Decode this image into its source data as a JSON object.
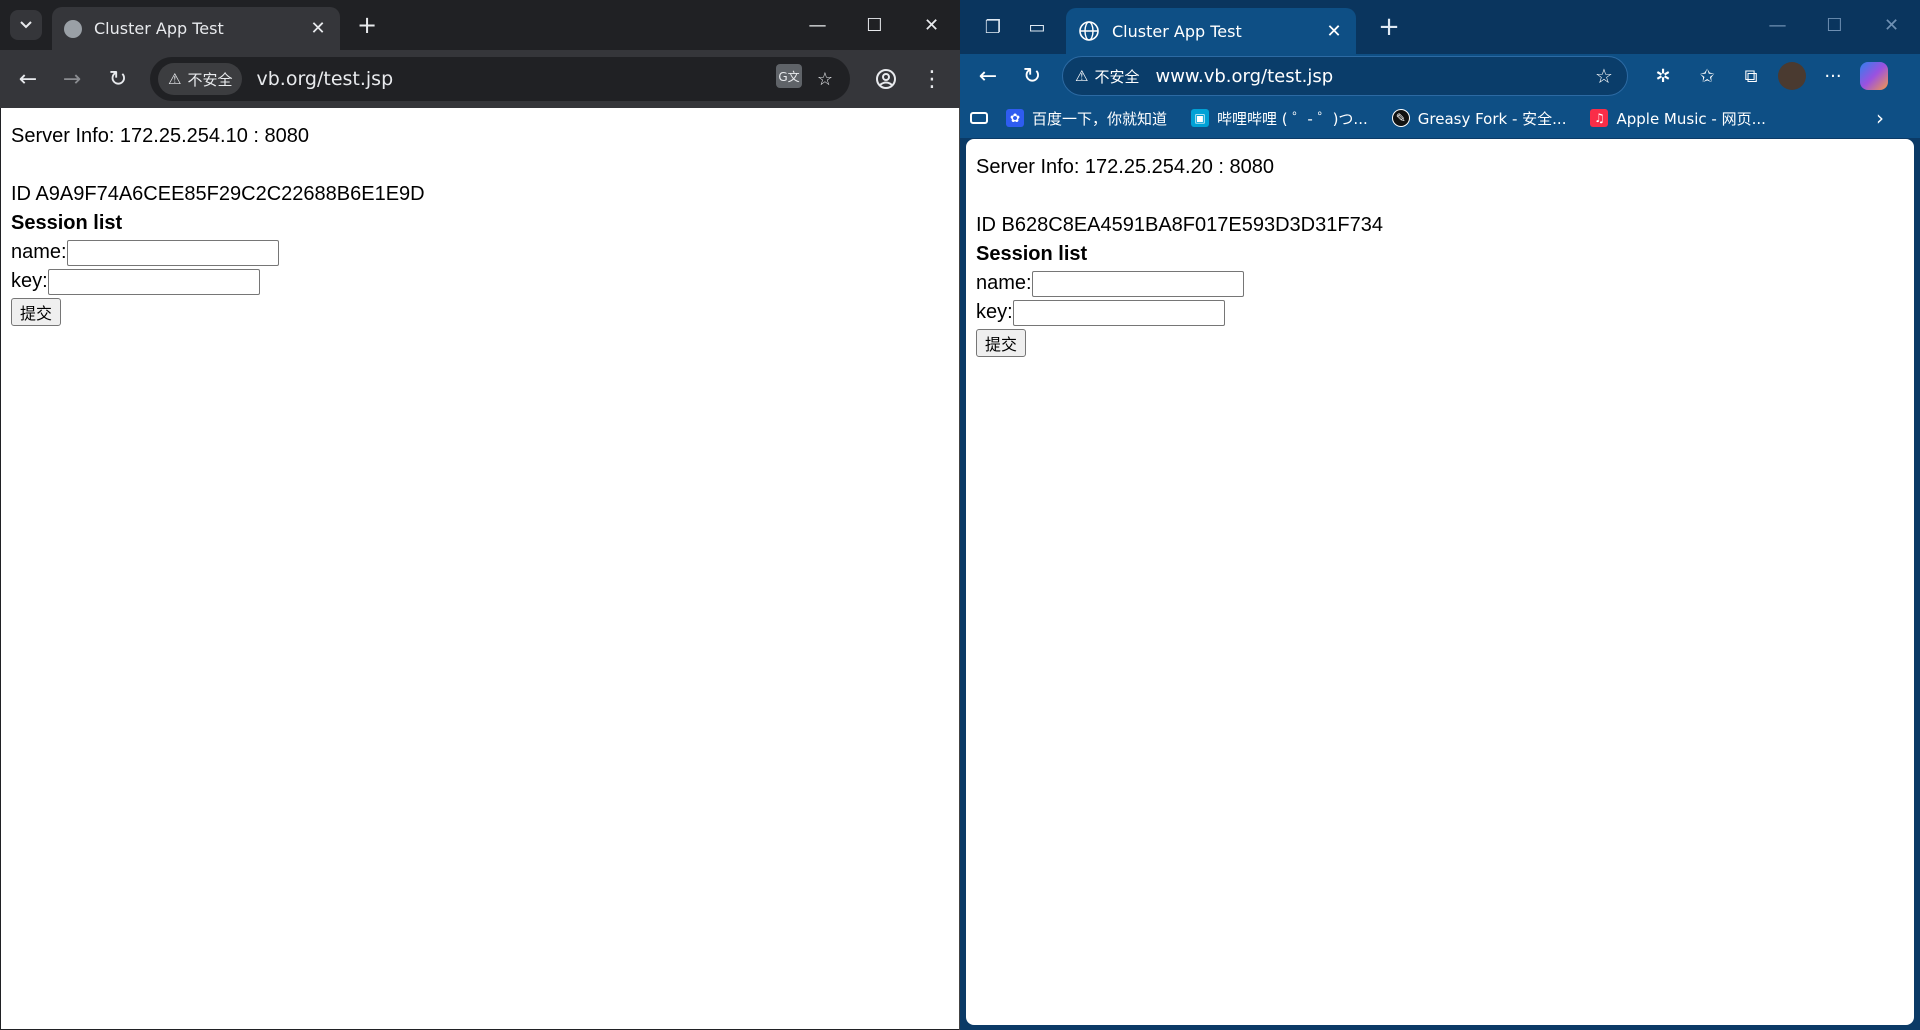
{
  "left_window": {
    "tab": {
      "title": "Cluster App Test",
      "favicon": "globe-icon"
    },
    "address": {
      "security_label": "不安全",
      "url": "vb.org/test.jsp"
    },
    "page": {
      "server_info": "Server Info: 172.25.254.10 : 8080",
      "session_id": "ID A9A9F74A6CEE85F29C2C22688B6E1E9D",
      "heading": "Session list",
      "name_label": "name:",
      "key_label": "key:",
      "submit_label": "提交"
    }
  },
  "right_window": {
    "tab": {
      "title": "Cluster App Test",
      "favicon": "globe-icon"
    },
    "address": {
      "security_label": "不安全",
      "url": "www.vb.org/test.jsp"
    },
    "favorites": [
      {
        "label": "百度一下，你就知道",
        "icon_color": "#2f5cf0"
      },
      {
        "label": "哔哩哔哩 ( ゜- ゜)つ...",
        "icon_color": "#00a1d6"
      },
      {
        "label": "Greasy Fork - 安全...",
        "icon_color": "#111111"
      },
      {
        "label": "Apple Music - 网页...",
        "icon_color": "#fa2d48"
      }
    ],
    "page": {
      "server_info": "Server Info: 172.25.254.20 : 8080",
      "session_id": "ID B628C8EA4591BA8F017E593D3D31F734",
      "heading": "Session list",
      "name_label": "name:",
      "key_label": "key:",
      "submit_label": "提交"
    }
  },
  "colors": {
    "chrome_frame": "#202124",
    "chrome_toolbar": "#35363a",
    "edge_frame": "#0a355e",
    "edge_toolbar": "#0e4f85"
  }
}
